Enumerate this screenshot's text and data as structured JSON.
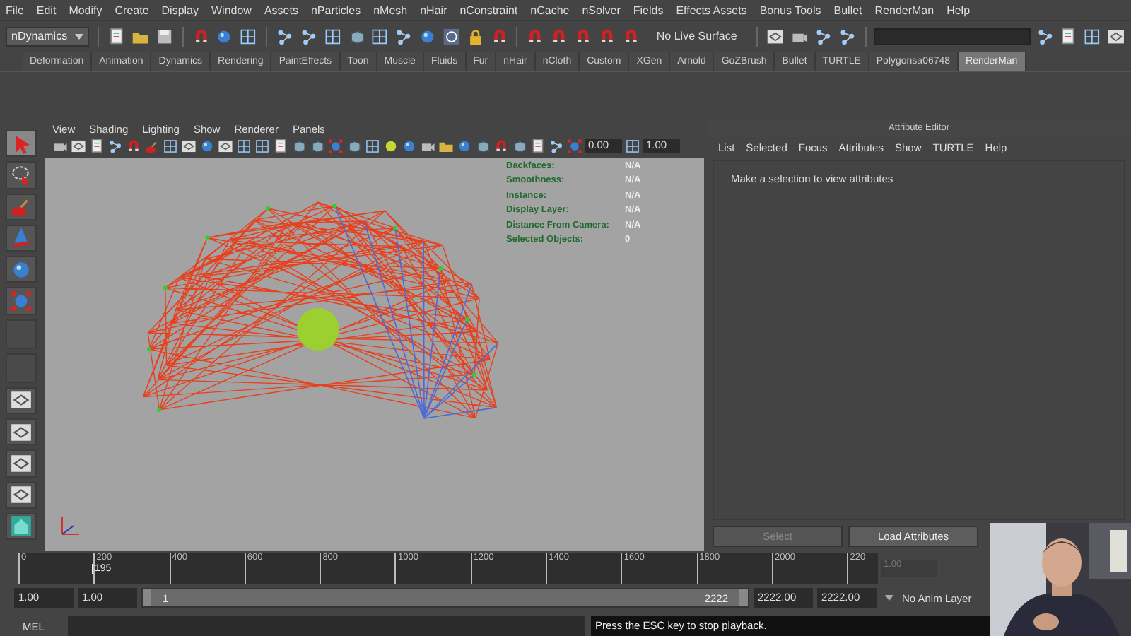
{
  "menu_bar": [
    "File",
    "Edit",
    "Modify",
    "Create",
    "Display",
    "Window",
    "Assets",
    "nParticles",
    "nMesh",
    "nHair",
    "nConstraint",
    "nCache",
    "nSolver",
    "Fields",
    "Effects Assets",
    "Bonus Tools",
    "Bullet",
    "RenderMan",
    "Help"
  ],
  "toolbar": {
    "mode": "nDynamics",
    "live_surface": "No Live Surface"
  },
  "shelf_tabs": [
    {
      "label": "Deformation",
      "selected": false
    },
    {
      "label": "Animation",
      "selected": false
    },
    {
      "label": "Dynamics",
      "selected": false
    },
    {
      "label": "Rendering",
      "selected": false
    },
    {
      "label": "PaintEffects",
      "selected": false
    },
    {
      "label": "Toon",
      "selected": false
    },
    {
      "label": "Muscle",
      "selected": false
    },
    {
      "label": "Fluids",
      "selected": false
    },
    {
      "label": "Fur",
      "selected": false
    },
    {
      "label": "nHair",
      "selected": false
    },
    {
      "label": "nCloth",
      "selected": false
    },
    {
      "label": "Custom",
      "selected": false
    },
    {
      "label": "XGen",
      "selected": false
    },
    {
      "label": "Arnold",
      "selected": false
    },
    {
      "label": "GoZBrush",
      "selected": false
    },
    {
      "label": "Bullet",
      "selected": false
    },
    {
      "label": "TURTLE",
      "selected": false
    },
    {
      "label": "Polygonsa06748",
      "selected": false
    },
    {
      "label": "RenderMan",
      "selected": true
    }
  ],
  "viewport": {
    "menu": [
      "View",
      "Shading",
      "Lighting",
      "Show",
      "Renderer",
      "Panels"
    ],
    "fields": [
      "0.00",
      "1.00"
    ],
    "hud": [
      {
        "label": "Backfaces:",
        "value": "N/A"
      },
      {
        "label": "Smoothness:",
        "value": "N/A"
      },
      {
        "label": "Instance:",
        "value": "N/A"
      },
      {
        "label": "Display Layer:",
        "value": "N/A"
      },
      {
        "label": "Distance From Camera:",
        "value": "N/A"
      },
      {
        "label": "Selected Objects:",
        "value": "0"
      }
    ]
  },
  "attribute_editor": {
    "title": "Attribute Editor",
    "menu": [
      "List",
      "Selected",
      "Focus",
      "Attributes",
      "Show",
      "TURTLE",
      "Help"
    ],
    "message": "Make a selection to view attributes",
    "buttons": [
      {
        "label": "Select",
        "disabled": true
      },
      {
        "label": "Load Attributes",
        "disabled": false
      }
    ]
  },
  "time_slider": {
    "ticks": [
      "0",
      "200",
      "400",
      "600",
      "800",
      "1000",
      "1200",
      "1400",
      "1600",
      "1800",
      "2000",
      "220"
    ],
    "current_frame": "195",
    "field": "1.00"
  },
  "range": {
    "start": "1.00",
    "playback_start": "1.00",
    "level": 1,
    "range_start": "1",
    "range_end": "2222",
    "playback_end": "2222.00",
    "end": "2222.00",
    "anim_layer": "No Anim Layer"
  },
  "command_line": {
    "label": "MEL",
    "help": "Press the ESC key to stop playback."
  }
}
